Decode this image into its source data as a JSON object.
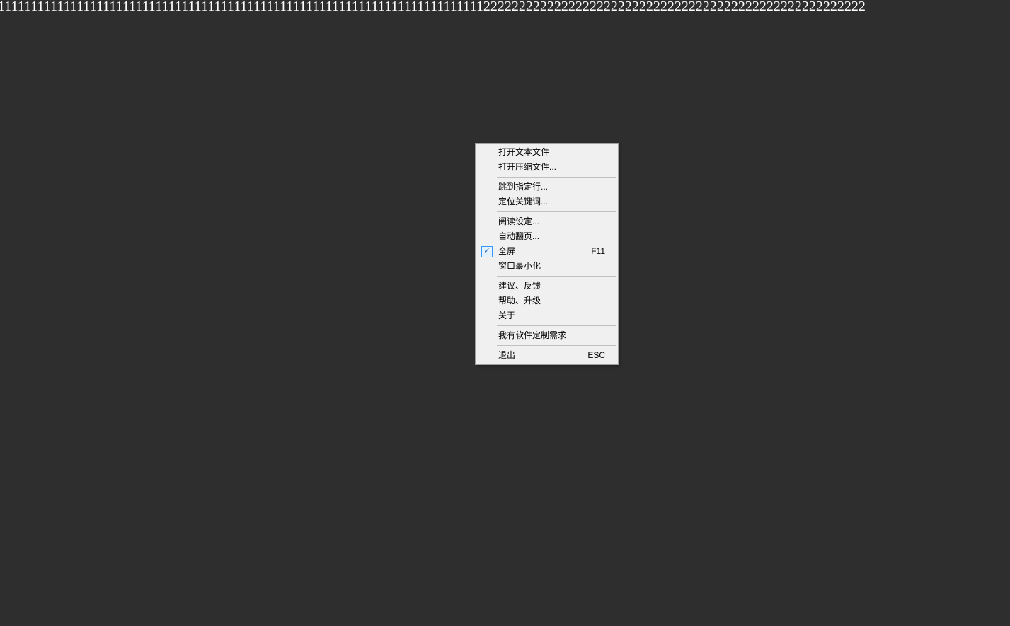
{
  "content": {
    "line1": "11111111111111111111111111111111111111111111111111111111111111111111111111222222222222222222222222222222222222222222222222222222"
  },
  "menu": {
    "open_text": "打开文本文件",
    "open_archive": "打开压缩文件...",
    "goto_line": "跳到指定行...",
    "find_keyword": "定位关键词...",
    "read_settings": "阅读设定...",
    "auto_page": "自动翻页...",
    "fullscreen": "全屏",
    "fullscreen_shortcut": "F11",
    "minimize": "窗口最小化",
    "feedback": "建议、反馈",
    "help_upgrade": "帮助、升级",
    "about": "关于",
    "custom_dev": "我有软件定制需求",
    "exit": "退出",
    "exit_shortcut": "ESC",
    "check_glyph": "✓"
  }
}
